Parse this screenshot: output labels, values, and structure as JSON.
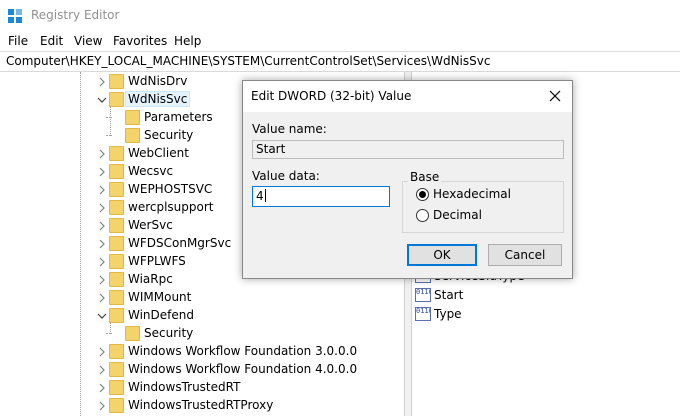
{
  "window": {
    "title": "Registry Editor"
  },
  "menu": [
    "File",
    "Edit",
    "View",
    "Favorites",
    "Help"
  ],
  "address": "Computer\\HKEY_LOCAL_MACHINE\\SYSTEM\\CurrentControlSet\\Services\\WdNisSvc",
  "tree": [
    {
      "label": "WdNisDrv",
      "expander": "collapsed",
      "level": 0
    },
    {
      "label": "WdNisSvc",
      "expander": "expanded",
      "level": 0,
      "selected": true
    },
    {
      "label": "Parameters",
      "expander": "none",
      "level": 1
    },
    {
      "label": "Security",
      "expander": "none",
      "level": 1
    },
    {
      "label": "WebClient",
      "expander": "collapsed",
      "level": 0
    },
    {
      "label": "Wecsvc",
      "expander": "collapsed",
      "level": 0
    },
    {
      "label": "WEPHOSTSVC",
      "expander": "collapsed",
      "level": 0
    },
    {
      "label": "wercplsupport",
      "expander": "collapsed",
      "level": 0
    },
    {
      "label": "WerSvc",
      "expander": "collapsed",
      "level": 0
    },
    {
      "label": "WFDSConMgrSvc",
      "expander": "collapsed",
      "level": 0
    },
    {
      "label": "WFPLWFS",
      "expander": "collapsed",
      "level": 0
    },
    {
      "label": "WiaRpc",
      "expander": "collapsed",
      "level": 0
    },
    {
      "label": "WIMMount",
      "expander": "collapsed",
      "level": 0
    },
    {
      "label": "WinDefend",
      "expander": "expanded",
      "level": 0
    },
    {
      "label": "Security",
      "expander": "none",
      "level": 1
    },
    {
      "label": "Windows Workflow Foundation 3.0.0.0",
      "expander": "collapsed",
      "level": 0
    },
    {
      "label": "Windows Workflow Foundation 4.0.0.0",
      "expander": "collapsed",
      "level": 0
    },
    {
      "label": "WindowsTrustedRT",
      "expander": "collapsed",
      "level": 0
    },
    {
      "label": "WindowsTrustedRTProxy",
      "expander": "collapsed",
      "level": 0
    }
  ],
  "values": [
    {
      "name": "ServiceSidType",
      "icon": "dword-value-icon"
    },
    {
      "name": "Start",
      "icon": "dword-value-icon"
    },
    {
      "name": "Type",
      "icon": "dword-value-icon"
    }
  ],
  "dialog": {
    "title": "Edit DWORD (32-bit) Value",
    "value_name_label": "Value name:",
    "value_name": "Start",
    "value_data_label": "Value data:",
    "value_data": "4",
    "base_label": "Base",
    "hex_label": "Hexadecimal",
    "dec_label": "Decimal",
    "base_selected": "Hexadecimal",
    "ok_label": "OK",
    "cancel_label": "Cancel"
  },
  "colors": {
    "accent": "#0078d7",
    "folder": "#f5d36b",
    "app_icon": "#1e88d8"
  }
}
